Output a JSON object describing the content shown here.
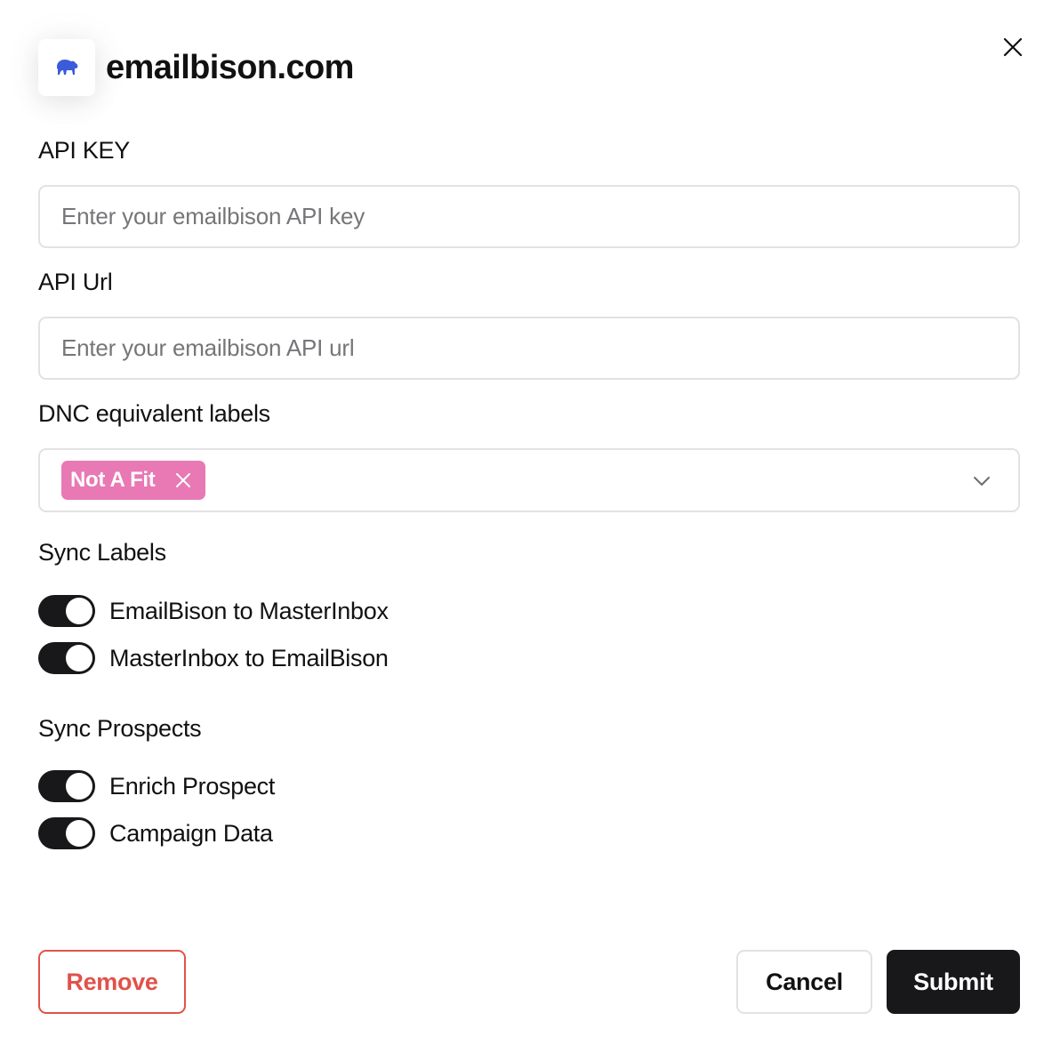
{
  "header": {
    "title": "emailbison.com",
    "logo_icon": "bison-icon",
    "logo_color": "#3b5bdb",
    "close_icon": "close-icon"
  },
  "api_key": {
    "label": "API KEY",
    "value": "",
    "placeholder": "Enter your emailbison API key"
  },
  "api_url": {
    "label": "API Url",
    "value": "",
    "placeholder": "Enter your emailbison API url"
  },
  "dnc_labels": {
    "label": "DNC equivalent labels",
    "selected": [
      {
        "text": "Not A Fit",
        "color": "#e879b4"
      }
    ],
    "dropdown_icon": "chevron-down-icon"
  },
  "sync_labels": {
    "title": "Sync Labels",
    "toggles": [
      {
        "label": "EmailBison to MasterInbox",
        "on": true
      },
      {
        "label": "MasterInbox to EmailBison",
        "on": true
      }
    ]
  },
  "sync_prospects": {
    "title": "Sync Prospects",
    "toggles": [
      {
        "label": "Enrich Prospect",
        "on": true
      },
      {
        "label": "Campaign Data",
        "on": true
      }
    ]
  },
  "footer": {
    "remove_label": "Remove",
    "cancel_label": "Cancel",
    "submit_label": "Submit",
    "danger_color": "#e0524a",
    "primary_color": "#18181b"
  }
}
